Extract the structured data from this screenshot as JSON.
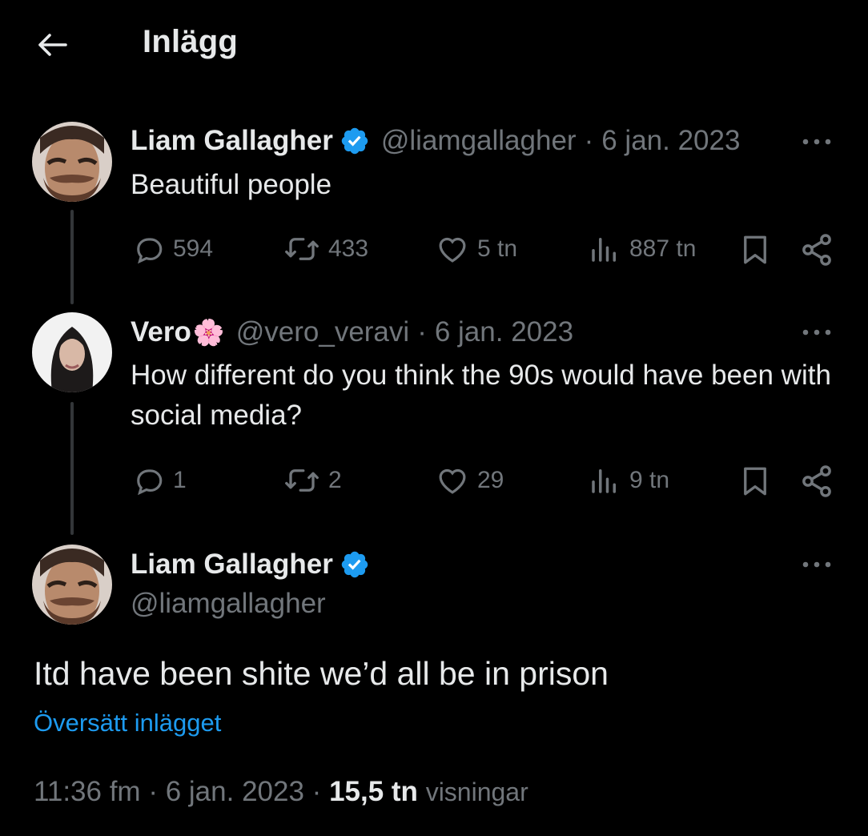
{
  "header": {
    "title": "Inlägg"
  },
  "post1": {
    "name": "Liam Gallagher",
    "handle": "@liamgallagher",
    "sep": "·",
    "date": "6 jan. 2023",
    "text": "Beautiful people",
    "replies": "594",
    "reposts": "433",
    "likes": "5 tn",
    "views": "887 tn"
  },
  "post2": {
    "name": "Vero",
    "name_emoji": "🌸",
    "handle": "@vero_veravi",
    "sep": "·",
    "date": "6 jan. 2023",
    "text": "How different do you think the 90s would have been with social media?",
    "replies": "1",
    "reposts": "2",
    "likes": "29",
    "views": "9 tn"
  },
  "main_post": {
    "name": "Liam Gallagher",
    "handle": "@liamgallagher",
    "text": "Itd have been shite we’d all be in prison",
    "translate": "Översätt inlägget",
    "time": "11:36 fm",
    "sep1": "·",
    "date": "6 jan. 2023",
    "sep2": "·",
    "views_count": "15,5 tn",
    "views_label": "visningar"
  },
  "icons": {
    "back": "arrow-left-icon",
    "verified": "verified-badge-icon",
    "more": "more-icon",
    "reply": "reply-icon",
    "repost": "repost-icon",
    "like": "heart-icon",
    "views": "analytics-icon",
    "bookmark": "bookmark-icon",
    "share": "share-icon"
  },
  "colors": {
    "background": "#000000",
    "text": "#e7e9ea",
    "muted": "#71767b",
    "accent": "#1d9bf0",
    "thread_line": "#333639"
  }
}
